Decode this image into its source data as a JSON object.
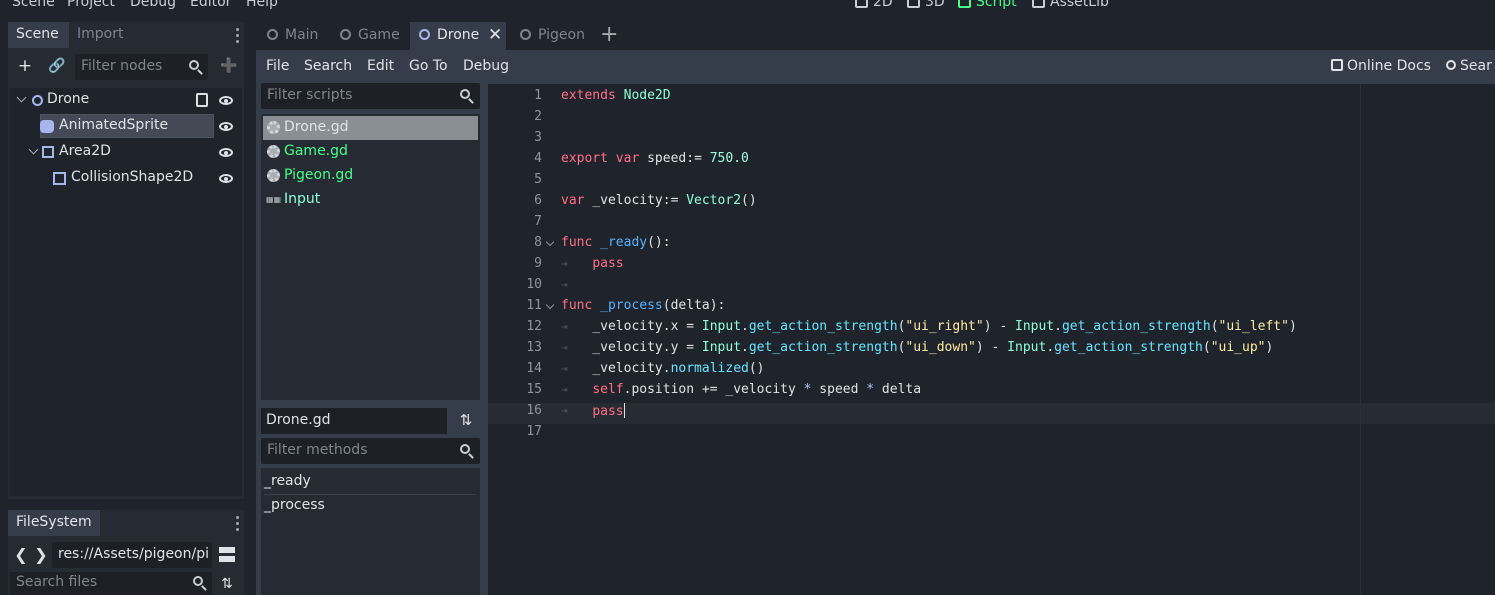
{
  "top_menu": [
    "Scene",
    "Project",
    "Debug",
    "Editor",
    "Help"
  ],
  "main_modes": [
    {
      "label": "2D",
      "active": false
    },
    {
      "label": "3D",
      "active": false
    },
    {
      "label": "Script",
      "active": true
    },
    {
      "label": "AssetLib",
      "active": false
    }
  ],
  "scene_dock": {
    "tabs": [
      "Scene",
      "Import"
    ],
    "filter_placeholder": "Filter nodes",
    "tree": [
      {
        "name": "Drone",
        "icon": "node2d-icon",
        "expanded": true,
        "has_script": true
      },
      {
        "name": "AnimatedSprite",
        "icon": "animated-sprite-icon",
        "selected": true
      },
      {
        "name": "Area2D",
        "icon": "area2d-icon",
        "expanded": true
      },
      {
        "name": "CollisionShape2D",
        "icon": "collision-shape-icon"
      }
    ]
  },
  "filesystem_dock": {
    "title": "FileSystem",
    "path": "res://Assets/pigeon/pi",
    "search_placeholder": "Search files"
  },
  "script_tabs": [
    {
      "label": "Main",
      "active": false
    },
    {
      "label": "Game",
      "active": false
    },
    {
      "label": "Drone",
      "active": true
    },
    {
      "label": "Pigeon",
      "active": false
    }
  ],
  "script_menu": [
    "File",
    "Search",
    "Edit",
    "Go To",
    "Debug"
  ],
  "script_right": {
    "online_docs": "Online Docs",
    "search_help": "Sear"
  },
  "scripts_panel": {
    "filter_placeholder": "Filter scripts",
    "items": [
      {
        "label": "Drone.gd",
        "color": "#e0e4ea",
        "selected": true,
        "icon": "gear-icon"
      },
      {
        "label": "Game.gd",
        "color": "#45ff8b",
        "icon": "gear-icon"
      },
      {
        "label": "Pigeon.gd",
        "color": "#45ff8b",
        "icon": "gear-icon"
      },
      {
        "label": "Input",
        "color": "#8effda",
        "icon": "doc-icon"
      }
    ],
    "current_script": "Drone.gd",
    "methods_placeholder": "Filter methods",
    "methods": [
      "_ready",
      "_process"
    ]
  },
  "code": {
    "line_numbers": [
      "1",
      "2",
      "3",
      "4",
      "5",
      "6",
      "7",
      "8",
      "9",
      "10",
      "11",
      "12",
      "13",
      "14",
      "15",
      "16",
      "17"
    ],
    "current_line": 16,
    "colors": {
      "keyword": "#ff7085",
      "type": "#8effda",
      "function": "#57b3ff",
      "number": "#a1ffe0",
      "string": "#ffeda1"
    },
    "lines": [
      [
        {
          "t": "extends",
          "c": "kw"
        },
        {
          "t": " "
        },
        {
          "t": "Node2D",
          "c": "ty"
        }
      ],
      [],
      [],
      [
        {
          "t": "export",
          "c": "kw"
        },
        {
          "t": " "
        },
        {
          "t": "var",
          "c": "kw"
        },
        {
          "t": " speed:= "
        },
        {
          "t": "750.0",
          "c": "num"
        }
      ],
      [],
      [
        {
          "t": "var",
          "c": "kw"
        },
        {
          "t": " _velocity:= "
        },
        {
          "t": "Vector2",
          "c": "ty"
        },
        {
          "t": "()"
        }
      ],
      [],
      [
        {
          "t": "func",
          "c": "kw"
        },
        {
          "t": " "
        },
        {
          "t": "_ready",
          "c": "fn"
        },
        {
          "t": "():"
        }
      ],
      [
        {
          "t": "    "
        },
        {
          "t": "pass",
          "c": "kw"
        }
      ],
      [],
      [
        {
          "t": "func",
          "c": "kw"
        },
        {
          "t": " "
        },
        {
          "t": "_process",
          "c": "fn"
        },
        {
          "t": "(delta):"
        }
      ],
      [
        {
          "t": "    _velocity.x = "
        },
        {
          "t": "Input",
          "c": "ty"
        },
        {
          "t": "."
        },
        {
          "t": "get_action_strength",
          "c": "fd"
        },
        {
          "t": "("
        },
        {
          "t": "\"ui_right\"",
          "c": "str"
        },
        {
          "t": ") - "
        },
        {
          "t": "Input",
          "c": "ty"
        },
        {
          "t": "."
        },
        {
          "t": "get_action_strength",
          "c": "fd"
        },
        {
          "t": "("
        },
        {
          "t": "\"ui_left\"",
          "c": "str"
        },
        {
          "t": ")"
        }
      ],
      [
        {
          "t": "    _velocity.y = "
        },
        {
          "t": "Input",
          "c": "ty"
        },
        {
          "t": "."
        },
        {
          "t": "get_action_strength",
          "c": "fd"
        },
        {
          "t": "("
        },
        {
          "t": "\"ui_down\"",
          "c": "str"
        },
        {
          "t": ") - "
        },
        {
          "t": "Input",
          "c": "ty"
        },
        {
          "t": "."
        },
        {
          "t": "get_action_strength",
          "c": "fd"
        },
        {
          "t": "("
        },
        {
          "t": "\"ui_up\"",
          "c": "str"
        },
        {
          "t": ")"
        }
      ],
      [
        {
          "t": "    _velocity."
        },
        {
          "t": "normalized",
          "c": "fd"
        },
        {
          "t": "()"
        }
      ],
      [
        {
          "t": "    "
        },
        {
          "t": "self",
          "c": "kw"
        },
        {
          "t": ".position += _velocity "
        },
        {
          "t": "*",
          "c": "op"
        },
        {
          "t": " speed "
        },
        {
          "t": "*",
          "c": "op"
        },
        {
          "t": " delta"
        }
      ],
      [
        {
          "t": "    "
        },
        {
          "t": "pass",
          "c": "kw"
        },
        {
          "t": "",
          "caret": true
        }
      ],
      []
    ]
  }
}
